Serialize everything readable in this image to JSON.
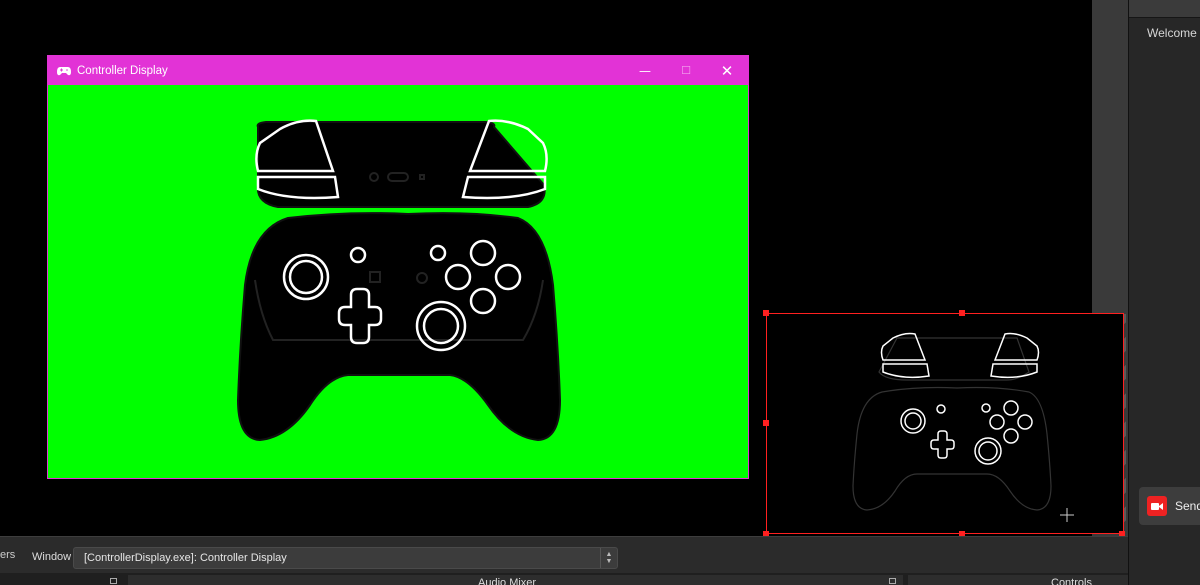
{
  "captured_window": {
    "title": "Controller Display",
    "title_bar_color": "#e233d6",
    "background_color": "#00ff00",
    "icon": "gamepad-icon",
    "buttons": {
      "minimize": "—",
      "maximize": "☐",
      "close": "✕"
    }
  },
  "dock": {
    "welcome_label": "Welcome",
    "send_button_label": "Send",
    "send_icon": "camera-icon",
    "accent": "#e22222"
  },
  "properties_bar": {
    "filters_label": "ers",
    "window_label": "Window",
    "window_value": "[ControllerDisplay.exe]: Controller Display"
  },
  "panels": {
    "audio_mixer": "Audio Mixer",
    "controls": "Controls"
  },
  "selection": {
    "handle_color": "#ff2020"
  }
}
